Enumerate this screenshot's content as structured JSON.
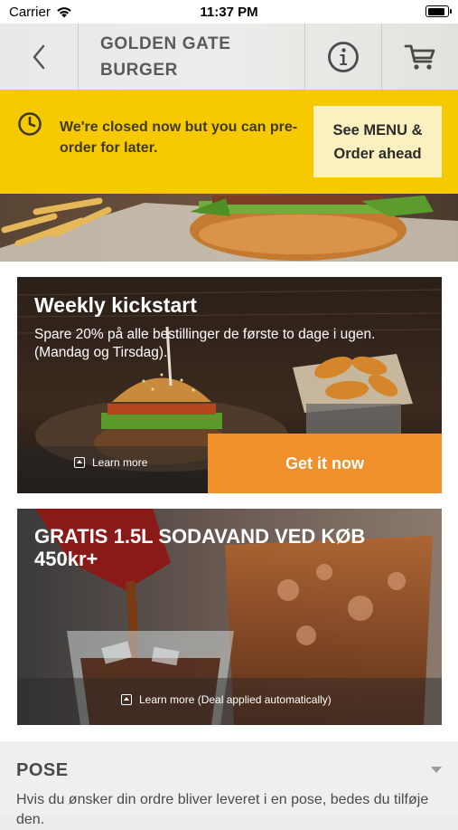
{
  "status_bar": {
    "carrier": "Carrier",
    "time": "11:37 PM"
  },
  "header": {
    "title_line1": "GOLDEN GATE",
    "title_line2": "BURGER",
    "icons": [
      "chevron-left-icon",
      "info-icon",
      "cart-icon"
    ]
  },
  "banner": {
    "message": "We're closed now but you can pre-order for later.",
    "button_line1": "See MENU &",
    "button_line2": "Order ahead",
    "color": "#f7c900"
  },
  "offers": [
    {
      "title": "Weekly kickstart",
      "description": "Spare 20% på alle bestillinger de første to dage i ugen. (Mandag og Tirsdag).",
      "learn_more": "Learn more",
      "cta": "Get it now",
      "cta_color": "#f0902a"
    },
    {
      "title": "GRATIS 1.5L SODAVAND VED KØB 450kr+",
      "learn_more": "Learn more (Deal applied automatically)"
    }
  ],
  "pose": {
    "title": "POSE",
    "description": "Hvis du ønsker din ordre bliver leveret i en pose, bedes du tilføje den."
  }
}
